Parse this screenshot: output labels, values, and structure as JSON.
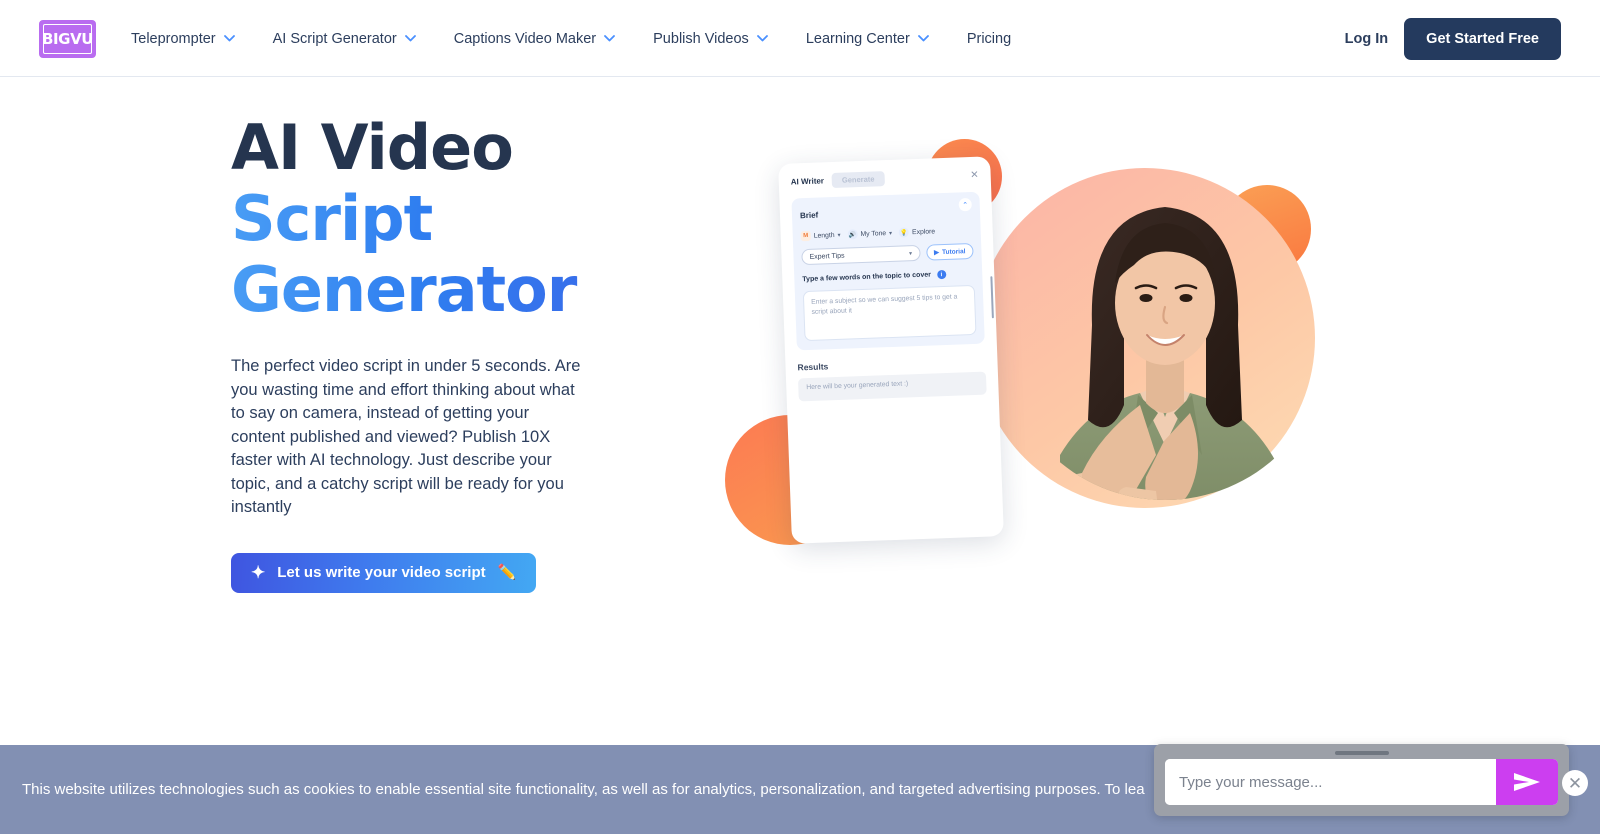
{
  "navbar": {
    "logo_text": "BIGVU",
    "items": [
      {
        "label": "Teleprompter",
        "has_chevron": true
      },
      {
        "label": "AI Script Generator",
        "has_chevron": true
      },
      {
        "label": "Captions Video Maker",
        "has_chevron": true
      },
      {
        "label": "Publish Videos",
        "has_chevron": true
      },
      {
        "label": "Learning Center",
        "has_chevron": true
      },
      {
        "label": "Pricing",
        "has_chevron": false
      }
    ],
    "login_label": "Log In",
    "cta_label": "Get Started Free",
    "cta_color": "#243a5e"
  },
  "hero": {
    "heading_line1": "AI Video",
    "heading_line2": "Script",
    "heading_line3": "Generator",
    "heading_dark_color": "#25354f",
    "heading_blue_color": "#3b7bf0",
    "paragraph": "The perfect video script in under 5 seconds. Are you wasting time and effort thinking about what to say on camera, instead of getting your content published and viewed? Publish 10X faster with AI technology. Just describe your topic, and a catchy script will be ready for you instantly",
    "cta_label": "Let us write your video script",
    "cta_spark_icon": "sparkles-icon",
    "cta_pencil_icon": "pencil-icon",
    "cta_spark_glyph": "✦",
    "cta_pencil_glyph": "✏️"
  },
  "app_mockup": {
    "title": "AI Writer",
    "generate_label": "Generate",
    "close_glyph": "✕",
    "brief_label": "Brief",
    "collapse_glyph": "⌃",
    "controls": [
      {
        "badge": "M",
        "label": "Length",
        "caret": "▾"
      },
      {
        "badge": "🔊",
        "label": "My Tone",
        "caret": "▾"
      },
      {
        "badge": "💡",
        "label": "Explore",
        "caret": ""
      }
    ],
    "select_value": "Expert Tips",
    "select_caret": "▾",
    "tutorial_label": "Tutorial",
    "tutorial_icon_glyph": "▶",
    "topic_label": "Type a few words on the topic to cover",
    "info_glyph": "i",
    "textarea_placeholder": "Enter a subject so we can suggest 5 tips to get a script about it",
    "results_label": "Results",
    "results_placeholder": "Here will be your generated text :)"
  },
  "cookie_banner": {
    "text": "This website utilizes technologies such as cookies to enable essential site functionality, as well as for analytics, personalization, and targeted advertising purposes. To lea",
    "background": "#8290b3"
  },
  "chat_widget": {
    "input_value": "",
    "input_placeholder": "Type your message...",
    "send_icon": "send-paper-plane-icon",
    "send_color": "#cc3ef0",
    "close_glyph": "✕"
  }
}
